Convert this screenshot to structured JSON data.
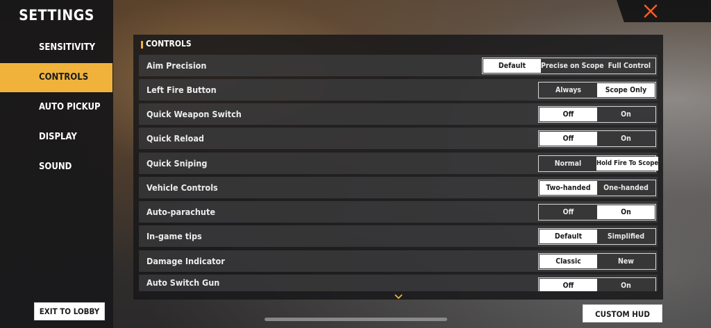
{
  "sidebar": {
    "title": "SETTINGS",
    "items": [
      {
        "label": "SENSITIVITY",
        "active": false
      },
      {
        "label": "CONTROLS",
        "active": true
      },
      {
        "label": "AUTO PICKUP",
        "active": false
      },
      {
        "label": "DISPLAY",
        "active": false
      },
      {
        "label": "SOUND",
        "active": false
      }
    ],
    "exit_label": "EXIT TO LOBBY"
  },
  "close": {
    "icon": "close-icon",
    "color": "#ff5a1f"
  },
  "section": {
    "title": "CONTROLS",
    "accent": "#f0b23b"
  },
  "rows": [
    {
      "label": "Aim Precision",
      "options": [
        "Default",
        "Precise on Scope",
        "Full Control"
      ],
      "selected": 0
    },
    {
      "label": "Left Fire Button",
      "options": [
        "Always",
        "Scope Only"
      ],
      "selected": 1
    },
    {
      "label": "Quick Weapon Switch",
      "options": [
        "Off",
        "On"
      ],
      "selected": 0
    },
    {
      "label": "Quick Reload",
      "options": [
        "Off",
        "On"
      ],
      "selected": 0
    },
    {
      "label": "Quick Sniping",
      "options": [
        "Normal",
        "Hold Fire To Scope"
      ],
      "selected": 1
    },
    {
      "label": "Vehicle Controls",
      "options": [
        "Two-handed",
        "One-handed"
      ],
      "selected": 0
    },
    {
      "label": "Auto-parachute",
      "options": [
        "Off",
        "On"
      ],
      "selected": 1
    },
    {
      "label": "In-game tips",
      "options": [
        "Default",
        "Simplified"
      ],
      "selected": 0
    },
    {
      "label": "Damage Indicator",
      "options": [
        "Classic",
        "New"
      ],
      "selected": 0
    },
    {
      "label": "Auto Switch Gun",
      "options": [
        "Off",
        "On"
      ],
      "selected": 0
    }
  ],
  "scroll_icon": "chevron-down-icon",
  "custom_hud_label": "CUSTOM HUD"
}
